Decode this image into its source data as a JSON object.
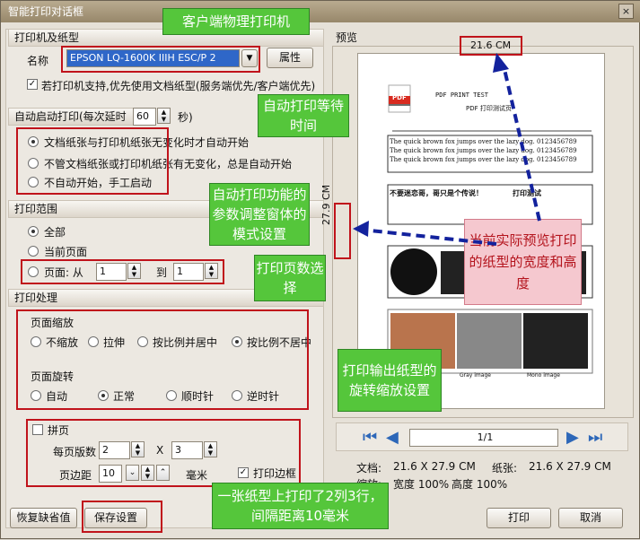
{
  "window": {
    "title": "智能打印对话框",
    "close": "×"
  },
  "printer": {
    "section": "打印机及纸型",
    "name_label": "名称",
    "name_value": "EPSON LQ-1600K IIIH ESC/P 2",
    "props": "属性",
    "prefer": "若打印机支持,优先使用文档纸型(服务端优先/客户端优先)"
  },
  "auto": {
    "section": "自动启动打印(每次延时",
    "delay": "60",
    "sec": "秒)",
    "opt1": "文档纸张与打印机纸张无变化时才自动开始",
    "opt2": "不管文档纸张或打印机纸张有无变化，总是自动开始",
    "opt3": "不自动开始，手工启动"
  },
  "range": {
    "section": "打印范围",
    "all": "全部",
    "current": "当前页面",
    "pages": "页面: 从",
    "from": "1",
    "to_label": "到",
    "to": "1"
  },
  "process": {
    "section": "打印处理",
    "scale_title": "页面缩放",
    "s1": "不缩放",
    "s2": "拉伸",
    "s3": "按比例并居中",
    "s4": "按比例不居中",
    "rotate_title": "页面旋转",
    "r1": "自动",
    "r2": "正常",
    "r3": "顺时针",
    "r4": "逆时针",
    "tile": "拼页",
    "per_page": "每页版数",
    "cols": "2",
    "x": "X",
    "rows": "3",
    "margin_label": "页边距",
    "margin": "10",
    "unit": "毫米",
    "border": "打印边框"
  },
  "buttons": {
    "restore": "恢复缺省值",
    "save": "保存设置",
    "print": "打印",
    "cancel": "取消"
  },
  "preview": {
    "title": "预览",
    "width_label": "21.6 CM",
    "height_label": "27.9 CM",
    "left_arrow": "<-",
    "right_arrow": "->",
    "up_caret": "^",
    "page": "1/1",
    "doc_label": "文档:",
    "doc_size": "21.6 X 27.9 CM",
    "paper_label": "纸张:",
    "paper_size": "21.6 X 27.9 CM",
    "zoom_label": "缩放:",
    "zoom_w": "宽度 100%",
    "zoom_h": "高度 100%"
  },
  "sample": {
    "pdf": "PDF",
    "test": "PDF PRINT TEST",
    "subtitle": "PDF 打印测试页",
    "quick1": "The quick brown fox jumps over the lazy dog. 0123456789",
    "quick2": "The quick brown fox jumps over the lazy dog. 0123456789",
    "quick3": "The quick brown fox jumps over the lazy dog. 0123456789",
    "cn1": "不要迷恋哥，哥只是个传说！",
    "cn2": "打印测试",
    "gray": "Gray image",
    "mono": "Mono image"
  },
  "annotations": {
    "c1": "客户端物理打印机",
    "c2": "自动打印等待时间",
    "c3": "自动打印功能的参数调整窗体的模式设置",
    "c4": "打印页数选择",
    "c5": "打印输出纸型的旋转缩放设置",
    "c6": "一张纸型上打印了2列3行，间隔距离10毫米",
    "c7": "当前实际预览打印的纸型的宽度和高度"
  }
}
